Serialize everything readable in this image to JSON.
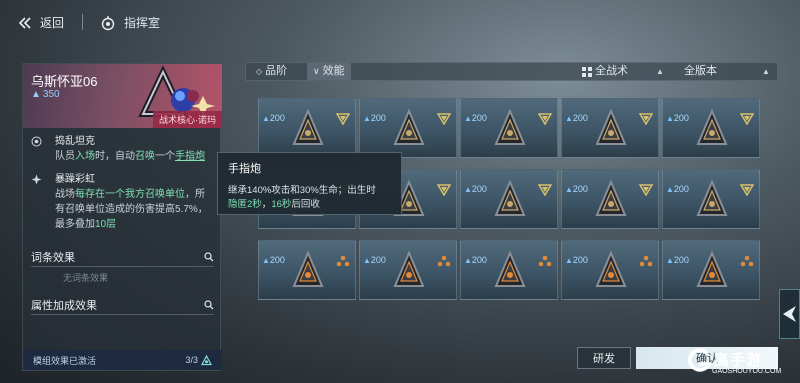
{
  "topbar": {
    "back_label": "返回",
    "title": "指挥室"
  },
  "character": {
    "name": "乌斯怀亚06",
    "cost": "350",
    "tag": "战术核心·诺玛"
  },
  "skills": [
    {
      "name": "捣乱坦克",
      "desc_prefix": "队员",
      "desc_hl1": "入场",
      "desc_mid": "时，自动",
      "desc_hl2": "召唤",
      "desc_mid2": "一个",
      "desc_link": "手指炮"
    },
    {
      "name": "暴躁彩虹",
      "line1_a": "战场",
      "line1_hl": "每存在一个我方召唤单位",
      "line1_b": "，所",
      "line2": "有召唤单位造成的伤害提高5.7%，",
      "line3_a": "最多叠加",
      "line3_hl": "10层"
    }
  ],
  "sections": {
    "entry_effects": "词条效果",
    "no_entry_effects": "无词条效果",
    "attribute_effects": "属性加成效果"
  },
  "module": {
    "label": "模组效果已激活",
    "count": "3/3"
  },
  "filters": {
    "tier": "品阶",
    "efficiency": "效能",
    "tactic": "全战术",
    "version": "全版本"
  },
  "grid": {
    "cost": "200",
    "rows": [
      [
        "gold",
        "gold",
        "gold",
        "gold",
        "gold"
      ],
      [
        "gold",
        "gold",
        "gold",
        "gold",
        "gold"
      ],
      [
        "orange",
        "orange",
        "orange",
        "orange",
        "orange"
      ]
    ]
  },
  "tooltip": {
    "title": "手指炮",
    "desc_line1": "继承140%攻击和30%生命；出生时",
    "desc_hl1": "隐匿2秒",
    "desc_sep": "，",
    "desc_hl2": "16秒",
    "desc_tail": "后回收"
  },
  "buttons": {
    "research": "研发",
    "confirm": "确认"
  },
  "watermark": {
    "name": "高手游",
    "url": "GAOSHOUYOU.COM"
  },
  "colors": {
    "accent_green": "#7fe0b3",
    "cost_blue": "#8fd0ff",
    "gold_badge": "#d9c06a",
    "orange_badge": "#e08a3a"
  }
}
